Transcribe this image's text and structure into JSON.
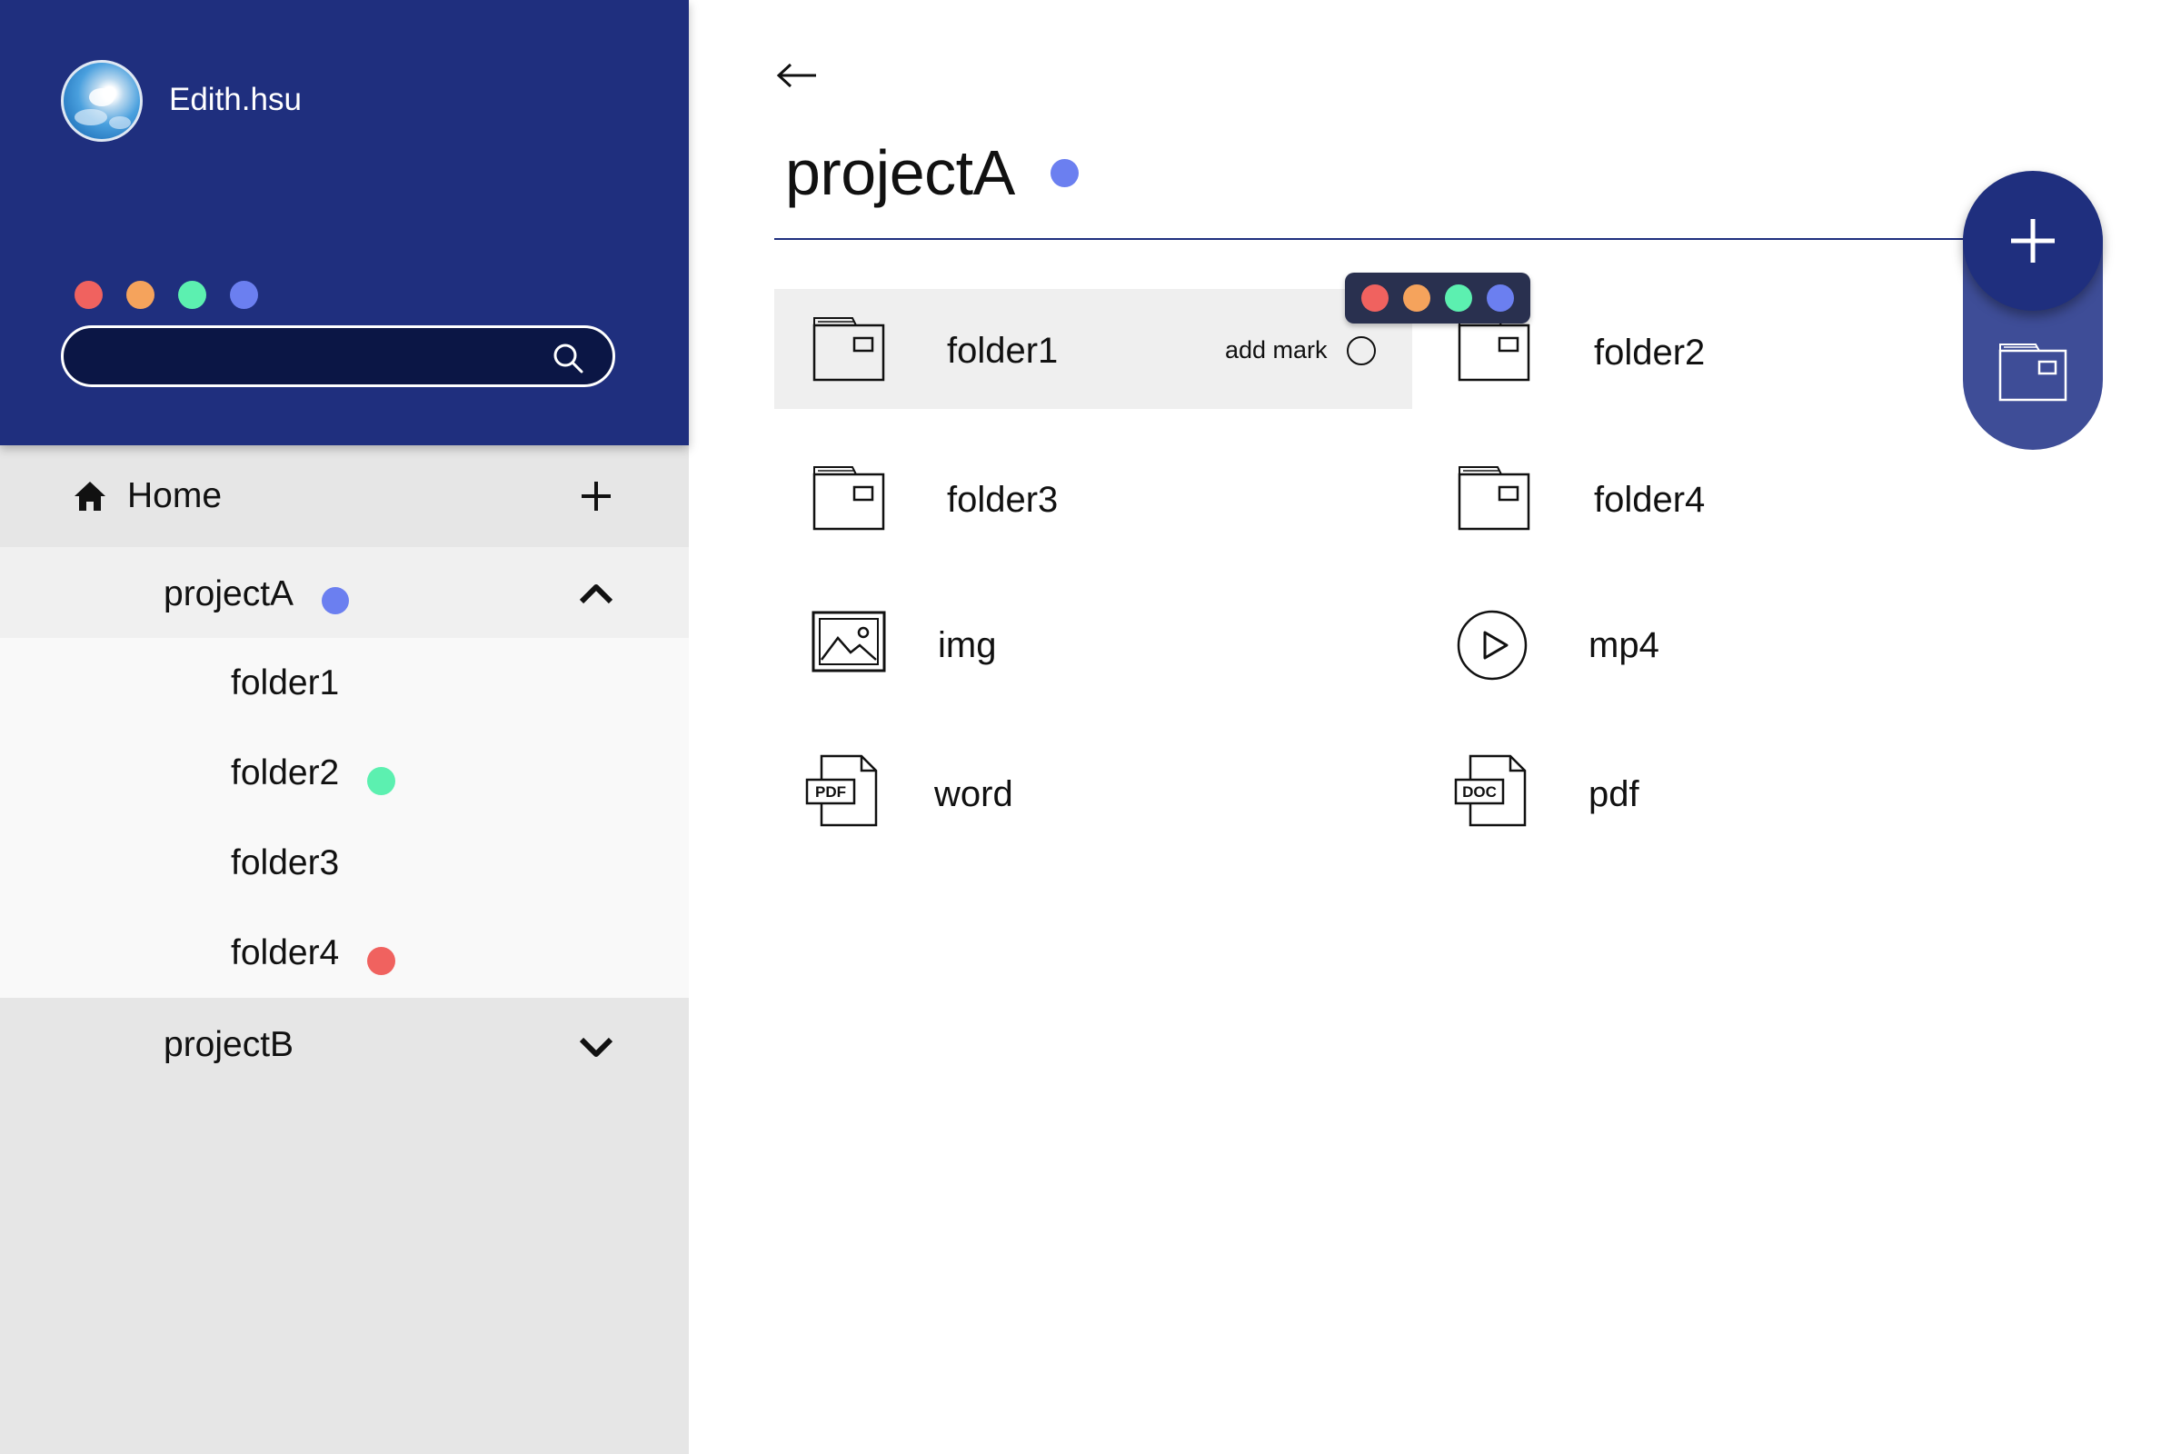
{
  "user": {
    "name": "Edith.hsu"
  },
  "colors": {
    "brand": "#1f2f7e",
    "search_bg": "#0b1645",
    "mark_red": "#f0625f",
    "mark_orange": "#f5a35c",
    "mark_green": "#5cf0b0",
    "mark_blue": "#6b7ff0"
  },
  "search": {
    "placeholder": ""
  },
  "sidebar": {
    "home_label": "Home",
    "projects": [
      {
        "label": "projectA",
        "mark": "blue",
        "expanded": true,
        "folders": [
          {
            "label": "folder1",
            "mark": null
          },
          {
            "label": "folder2",
            "mark": "green"
          },
          {
            "label": "folder3",
            "mark": null
          },
          {
            "label": "folder4",
            "mark": "red"
          }
        ]
      },
      {
        "label": "projectB",
        "mark": null,
        "expanded": false
      }
    ]
  },
  "main": {
    "title": "projectA",
    "title_mark": "blue",
    "add_mark_label": "add mark",
    "items": [
      {
        "label": "folder1",
        "icon": "folder-icon",
        "hovered": true
      },
      {
        "label": "folder2",
        "icon": "folder-icon"
      },
      {
        "label": "folder3",
        "icon": "folder-icon"
      },
      {
        "label": "folder4",
        "icon": "folder-icon"
      },
      {
        "label": "img",
        "icon": "image-icon"
      },
      {
        "label": "mp4",
        "icon": "play-icon"
      },
      {
        "label": "word",
        "icon": "pdf-file-icon",
        "icon_text": "PDF"
      },
      {
        "label": "pdf",
        "icon": "doc-file-icon",
        "icon_text": "DOC"
      }
    ]
  }
}
